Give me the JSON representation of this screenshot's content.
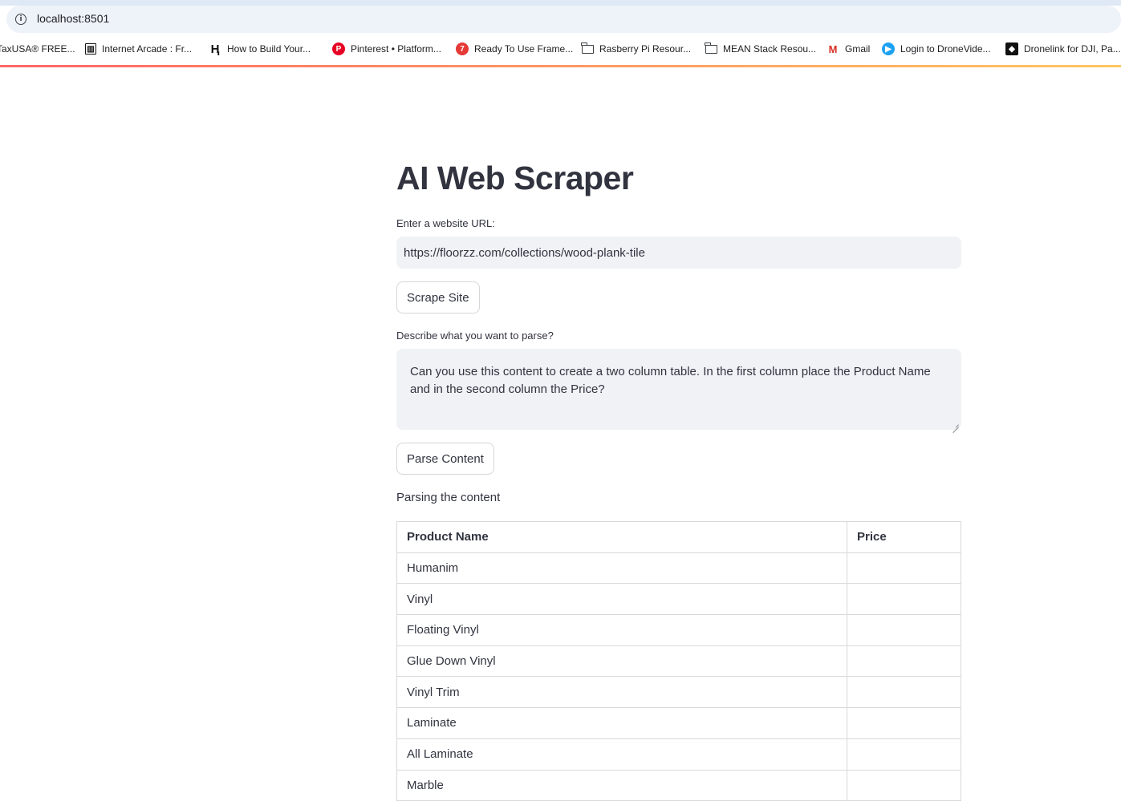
{
  "browser": {
    "url": "localhost:8501",
    "bookmarks": [
      {
        "label": "TaxUSA® FREE...",
        "icon": "none"
      },
      {
        "label": "Internet Arcade : Fr...",
        "icon": "archive-icon"
      },
      {
        "label": "How to Build Your...",
        "icon": "h-logo-icon"
      },
      {
        "label": "Pinterest • Platform...",
        "icon": "pinterest-icon"
      },
      {
        "label": "Ready To Use Frame...",
        "icon": "seven-icon"
      },
      {
        "label": "Rasberry Pi Resour...",
        "icon": "folder-icon"
      },
      {
        "label": "MEAN Stack Resou...",
        "icon": "folder-icon"
      },
      {
        "label": "Gmail",
        "icon": "gmail-icon"
      },
      {
        "label": "Login to DroneVide...",
        "icon": "play-icon"
      },
      {
        "label": "Dronelink for DJI, Pa...",
        "icon": "dronelink-icon"
      }
    ]
  },
  "app": {
    "title": "AI Web Scraper",
    "url_label": "Enter a website URL:",
    "url_value": "https://floorzz.com/collections/wood-plank-tile",
    "scrape_button": "Scrape Site",
    "parse_label": "Describe what you want to parse?",
    "parse_value": "Can you use this content to create a two column table. In the first column place the Product Name and in the second column the Price?",
    "parse_button": "Parse Content",
    "status": "Parsing the content",
    "table": {
      "headers": [
        "Product Name",
        "Price"
      ],
      "rows": [
        [
          "Humanim",
          ""
        ],
        [
          "Vinyl",
          ""
        ],
        [
          "Floating Vinyl",
          ""
        ],
        [
          "Glue Down Vinyl",
          ""
        ],
        [
          "Vinyl Trim",
          ""
        ],
        [
          "Laminate",
          ""
        ],
        [
          "All Laminate",
          ""
        ],
        [
          "Marble",
          ""
        ]
      ]
    }
  },
  "colors": {
    "accent_start": "#ff4b4b",
    "accent_end": "#ffbd45",
    "input_bg": "#f0f2f6",
    "text": "#31333f"
  }
}
